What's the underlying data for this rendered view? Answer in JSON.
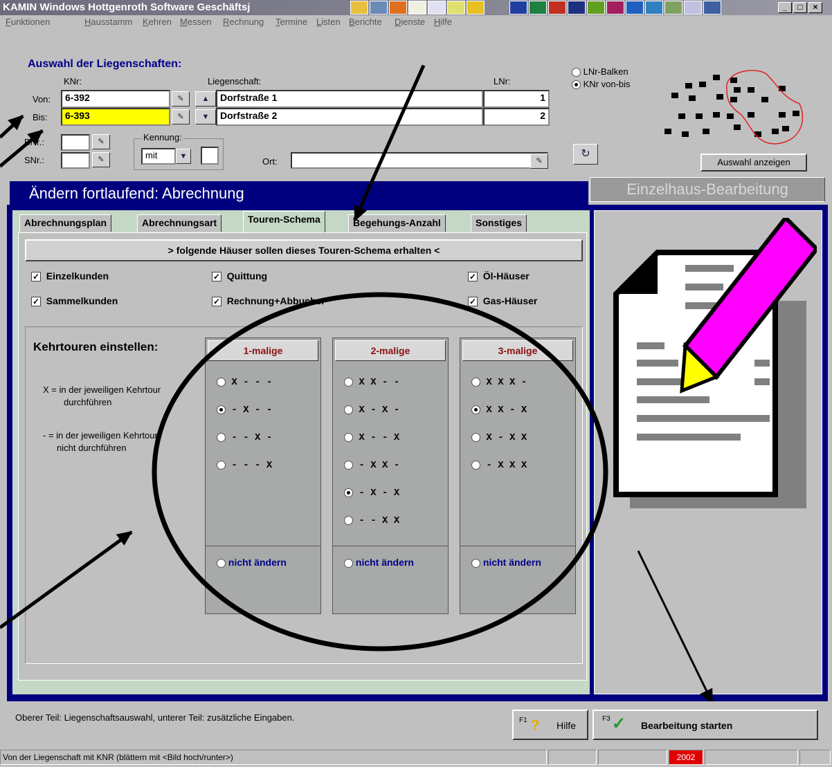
{
  "title": "KAMIN Windows  Hottgenroth Software    Geschäftsj",
  "menu": [
    "Funktionen",
    "Hausstamm",
    "Kehren",
    "Messen",
    "Rechnung",
    "Termine",
    "Listen",
    "Berichte",
    "Dienste",
    "Hilfe"
  ],
  "auswahl": {
    "heading": "Auswahl der Liegenschaften:",
    "knr_label": "KNr:",
    "liegenschaft_label": "Liegenschaft:",
    "lnr_label": "LNr:",
    "von_label": "Von:",
    "bis_label": "Bis:",
    "von_knr": "6-392",
    "bis_knr": "6-393",
    "von_liegenschaft": "Dorfstraße 1",
    "bis_liegenschaft": "Dorfstraße 2",
    "von_lnr": "1",
    "bis_lnr": "2",
    "bnr_label": "BNr.:",
    "snr_label": "SNr.:",
    "kennung_label": "Kennung:",
    "kennung_value": "mit",
    "ort_label": "Ort:",
    "radio_lnr": "LNr-Balken",
    "radio_knr": "KNr von-bis",
    "auswahl_btn": "Auswahl anzeigen",
    "bis_color": "#ffff00"
  },
  "header_left": "Ändern fortlaufend: Abrechnung",
  "header_right": "Einzelhaus-Bearbeitung",
  "tabs": [
    "Abrechnungsplan",
    "Abrechnungsart",
    "Touren-Schema",
    "Begehungs-Anzahl",
    "Sonstiges"
  ],
  "banner": "> folgende Häuser sollen dieses Touren-Schema erhalten <",
  "checks": [
    "Einzelkunden",
    "Sammelkunden",
    "Quittung",
    "Rechnung+Abbucher",
    "Öl-Häuser",
    "Gas-Häuser"
  ],
  "kehr": {
    "title": "Kehrtouren einstellen:",
    "legend1a": "X = in der jeweiligen Kehrtour",
    "legend1b": "durchführen",
    "legend2a": "- = in der jeweiligen Kehrtour",
    "legend2b": "nicht durchführen"
  },
  "columns": [
    {
      "head": "1-malige",
      "options": [
        "X - - -",
        "- X - -",
        "- - X -",
        "- - - X"
      ],
      "selected": 1
    },
    {
      "head": "2-malige",
      "options": [
        "X X - -",
        "X - X -",
        "X - - X",
        "- X X -",
        "- X - X",
        "- - X X"
      ],
      "selected": 4
    },
    {
      "head": "3-malige",
      "options": [
        "X X X -",
        "X X - X",
        "X - X X",
        "- X X X"
      ],
      "selected": 1
    }
  ],
  "nicht": "nicht ändern",
  "status_msg": "Oberer Teil: Liegenschaftsauswahl,  unterer Teil: zusätzliche Eingaben.",
  "hilfe_key": "F1",
  "hilfe": "Hilfe",
  "start_key": "F3",
  "start": "Bearbeitung starten",
  "statusbar": "Von der Liegenschaft mit KNR  (blättern mit <Bild hoch/runter>)",
  "year": "2002"
}
